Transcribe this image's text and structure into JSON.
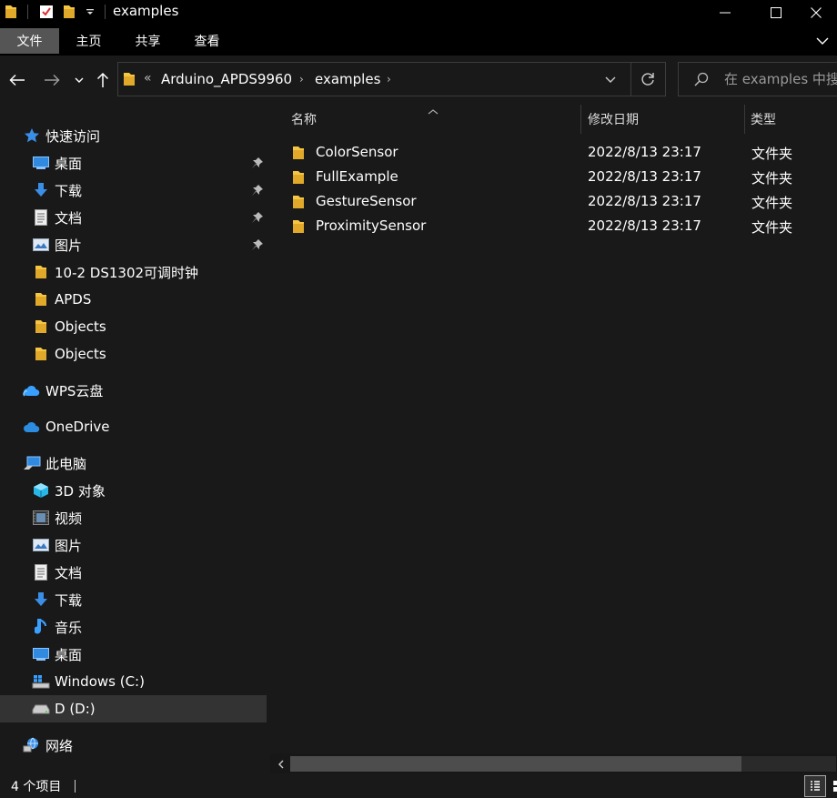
{
  "window": {
    "title": "examples",
    "controls": {
      "minimize": "minimize",
      "maximize": "maximize",
      "close": "close"
    }
  },
  "ribbon": {
    "tabs": [
      {
        "label": "文件",
        "active": true
      },
      {
        "label": "主页"
      },
      {
        "label": "共享"
      },
      {
        "label": "查看"
      }
    ]
  },
  "address": {
    "overflow_glyph": "«",
    "crumbs": [
      "Arduino_APDS9960",
      "examples"
    ],
    "separator": "›"
  },
  "search": {
    "placeholder": "在 examples 中搜索"
  },
  "nav": {
    "quick_access": {
      "label": "快速访问",
      "items": [
        {
          "label": "桌面",
          "icon": "desktop-icon",
          "pinned": true
        },
        {
          "label": "下载",
          "icon": "download-icon",
          "pinned": true
        },
        {
          "label": "文档",
          "icon": "document-icon",
          "pinned": true
        },
        {
          "label": "图片",
          "icon": "pictures-icon",
          "pinned": true
        },
        {
          "label": "10-2 DS1302可调时钟",
          "icon": "folder-icon"
        },
        {
          "label": "APDS",
          "icon": "folder-icon"
        },
        {
          "label": "Objects",
          "icon": "folder-icon"
        },
        {
          "label": "Objects",
          "icon": "folder-icon"
        }
      ]
    },
    "wps": {
      "label": "WPS云盘",
      "icon": "cloud-icon"
    },
    "onedrive": {
      "label": "OneDrive",
      "icon": "cloud-icon"
    },
    "this_pc": {
      "label": "此电脑",
      "items": [
        {
          "label": "3D 对象",
          "icon": "3d-objects-icon"
        },
        {
          "label": "视频",
          "icon": "video-icon"
        },
        {
          "label": "图片",
          "icon": "pictures-icon"
        },
        {
          "label": "文档",
          "icon": "document-icon"
        },
        {
          "label": "下载",
          "icon": "download-icon"
        },
        {
          "label": "音乐",
          "icon": "music-icon"
        },
        {
          "label": "桌面",
          "icon": "desktop-icon"
        },
        {
          "label": "Windows (C:)",
          "icon": "windows-drive-icon"
        },
        {
          "label": "D (D:)",
          "icon": "drive-icon",
          "selected": true
        }
      ]
    },
    "network": {
      "label": "网络",
      "icon": "network-icon"
    }
  },
  "columns": {
    "name": "名称",
    "modified": "修改日期",
    "type": "类型"
  },
  "files": [
    {
      "name": "ColorSensor",
      "modified": "2022/8/13 23:17",
      "type": "文件夹"
    },
    {
      "name": "FullExample",
      "modified": "2022/8/13 23:17",
      "type": "文件夹"
    },
    {
      "name": "GestureSensor",
      "modified": "2022/8/13 23:17",
      "type": "文件夹"
    },
    {
      "name": "ProximitySensor",
      "modified": "2022/8/13 23:17",
      "type": "文件夹"
    }
  ],
  "status": {
    "item_count": "4 个项目"
  },
  "colors": {
    "background": "#191919",
    "titlebar": "#000000",
    "selected": "#333333",
    "folder": "#f5c543",
    "accent": "#3a8ee6"
  }
}
